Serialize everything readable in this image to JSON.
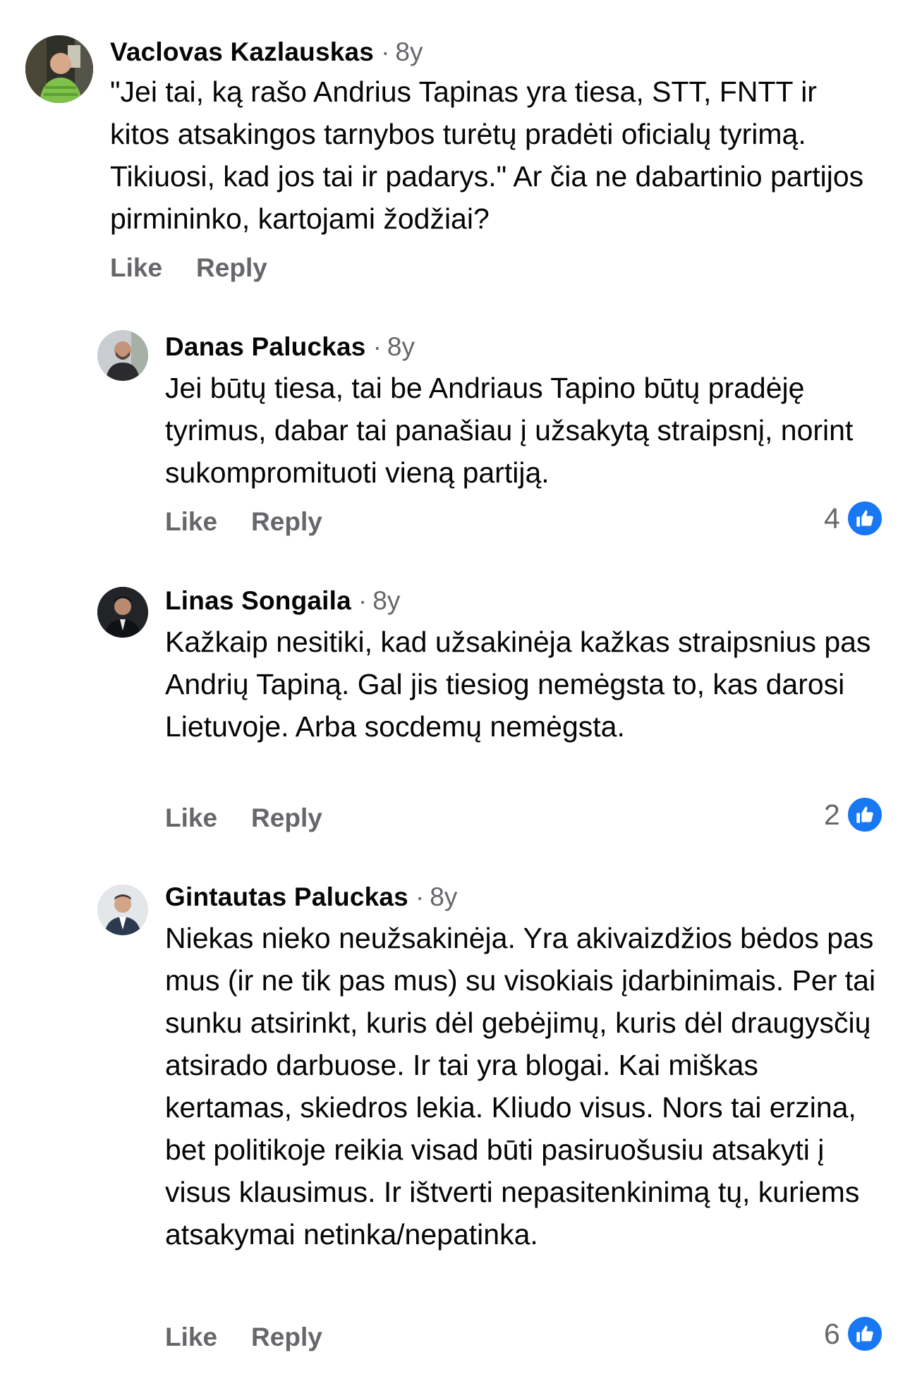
{
  "comments": [
    {
      "author": "Vaclovas Kazlauskas",
      "separator": "·",
      "time": "8y",
      "text": "\"Jei tai, ką rašo Andrius Tapinas yra tiesa, STT, FNTT ir kitos atsakingos tarnybos turėtų pradėti oficialų tyrimą. Tikiuosi, kad jos tai ir padarys.\" Ar čia ne dabartinio partijos pirmininko, kartojami žodžiai?",
      "like_label": "Like",
      "reply_label": "Reply"
    },
    {
      "author": "Danas Paluckas",
      "separator": "·",
      "time": "8y",
      "text": "Jei būtų tiesa, tai be Andriaus Tapino būtų pradėję tyrimus, dabar tai panašiau į užsakytą straipsnį, norint sukompromituoti vieną partiją.",
      "like_label": "Like",
      "reply_label": "Reply",
      "reaction_count": "4",
      "reaction_icon": "like-reaction-icon"
    },
    {
      "author": "Linas Songaila",
      "separator": "·",
      "time": "8y",
      "text": "Kažkaip nesitiki, kad užsakinėja kažkas straipsnius pas Andrių Tapiną. Gal jis tiesiog nemėgsta to, kas darosi Lietuvoje. Arba socdemų nemėgsta.",
      "like_label": "Like",
      "reply_label": "Reply",
      "reaction_count": "2",
      "reaction_icon": "like-reaction-icon"
    },
    {
      "author": "Gintautas Paluckas",
      "separator": "·",
      "time": "8y",
      "text": "Niekas nieko neužsakinėja. Yra akivaizdžios bėdos pas mus (ir ne tik pas mus) su visokiais įdarbinimais. Per tai sunku atsirinkt, kuris dėl gebėjimų, kuris dėl draugysčių atsirado darbuose. Ir tai yra blogai. Kai miškas kertamas, skiedros lekia. Kliudo visus. Nors tai erzina, bet politikoje reikia visad būti pasiruošusiu atsakyti į visus klausimus. Ir ištverti nepasitenkinimą tų, kuriems atsakymai netinka/nepatinka.",
      "like_label": "Like",
      "reply_label": "Reply",
      "reaction_count": "6",
      "reaction_icon": "like-reaction-icon"
    }
  ],
  "colors": {
    "text_primary": "#050505",
    "text_secondary": "#65676b",
    "like_blue": "#1877f2",
    "background": "#ffffff"
  }
}
